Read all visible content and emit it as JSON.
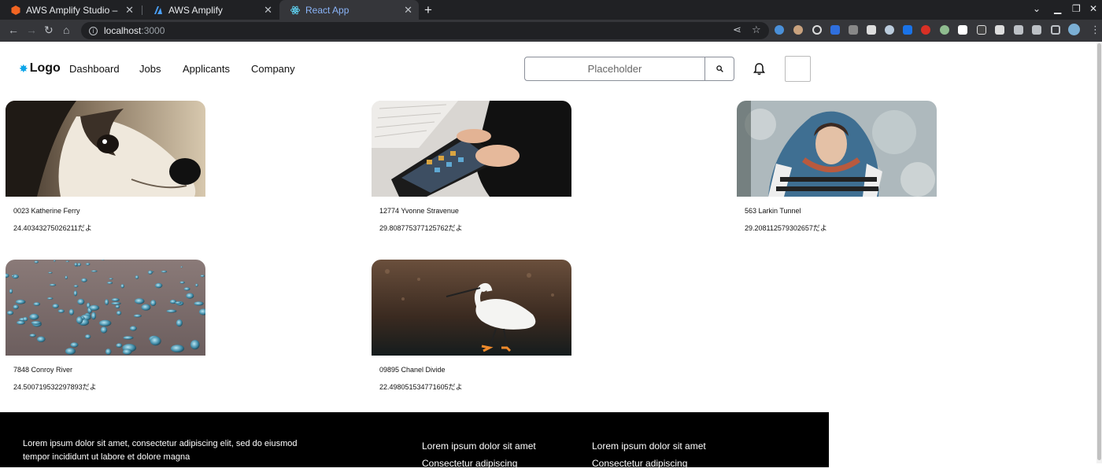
{
  "browser": {
    "tabs": [
      {
        "title": "AWS Amplify Studio – 最|",
        "favicon": "amplify-studio-icon",
        "color": "#f26522"
      },
      {
        "title": "AWS Amplify",
        "favicon": "amplify-icon",
        "color": "#4a9ff5"
      },
      {
        "title": "React App",
        "favicon": "react-icon",
        "color": "#61dafb",
        "active": true
      }
    ],
    "url_host": "localhost",
    "url_port": ":3000"
  },
  "header": {
    "logo": "Logo",
    "nav": [
      "Dashboard",
      "Jobs",
      "Applicants",
      "Company"
    ],
    "search_placeholder": "Placeholder"
  },
  "cards": [
    {
      "address": "0023 Katherine Ferry",
      "price": "24.40343275026211だよ",
      "image": "dog"
    },
    {
      "address": "12774 Yvonne Stravenue",
      "price": "29.808775377125762だよ",
      "image": "tablet"
    },
    {
      "address": "563 Larkin Tunnel",
      "price": "29.208112579302657だよ",
      "image": "woman-scarf"
    },
    {
      "address": "7848 Conroy River",
      "price": "24.500719532297893だよ",
      "image": "water-drops"
    },
    {
      "address": "09895 Chanel Divide",
      "price": "22.498051534771605だよ",
      "image": "egret"
    }
  ],
  "footer": {
    "text": "Lorem ipsum dolor sit amet, consectetur adipiscing elit, sed do eiusmod tempor incididunt ut labore et dolore magna",
    "col1": {
      "heading": "Lorem ipsum dolor sit amet",
      "item": "Consectetur adipiscing"
    },
    "col2": {
      "heading": "Lorem ipsum dolor sit amet",
      "item": "Consectetur adipiscing"
    }
  }
}
